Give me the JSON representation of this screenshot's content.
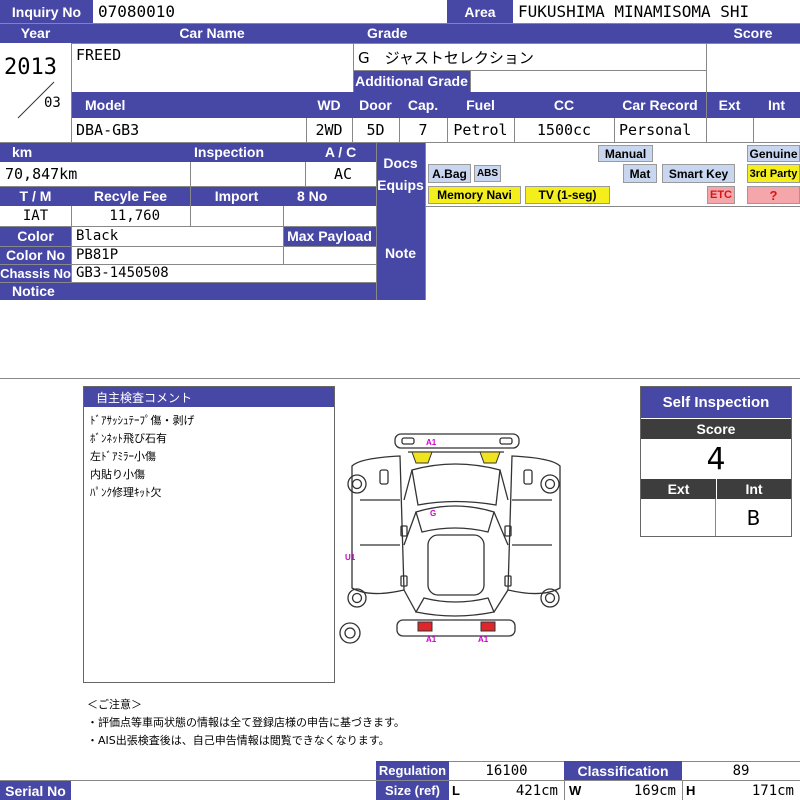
{
  "header": {
    "inquiry_label": "Inquiry No",
    "inquiry_value": "07080010",
    "area_label": "Area",
    "area_value": "FUKUSHIMA MINAMISOMA SHI"
  },
  "vehicle": {
    "year_label": "Year",
    "year_value": "2013",
    "month_value": "03",
    "car_name_label": "Car Name",
    "car_name_value": "FREED",
    "grade_label": "Grade",
    "grade_value": "G　ジャストセレクション",
    "additional_grade_label": "Additional Grade",
    "score_label": "Score",
    "score_value": ""
  },
  "specs": {
    "model_label": "Model",
    "model_value": "DBA-GB3",
    "wd_label": "WD",
    "wd_value": "2WD",
    "door_label": "Door",
    "door_value": "5D",
    "cap_label": "Cap.",
    "cap_value": "7",
    "fuel_label": "Fuel",
    "fuel_value": "Petrol",
    "cc_label": "CC",
    "cc_value": "1500cc",
    "record_label": "Car Record",
    "record_value": "Personal",
    "ext_label": "Ext",
    "int_label": "Int"
  },
  "details": {
    "km_label": "km",
    "km_value": "70,847km",
    "inspection_label": "Inspection",
    "ac_label": "A / C",
    "ac_value": "AC",
    "tm_label": "T / M",
    "tm_value": "IAT",
    "recycle_label": "Recyle Fee",
    "recycle_value": "11,760",
    "import_label": "Import",
    "eight_no_label": "8 No",
    "color_label": "Color",
    "color_value": "Black",
    "max_payload_label": "Max Payload",
    "color_no_label": "Color No",
    "color_no_value": "PB81P",
    "chassis_label": "Chassis No",
    "chassis_value": "GB3-1450508",
    "notice_label": "Notice"
  },
  "equipment": {
    "docs_label": "Docs",
    "equips_label": "Equips",
    "note_label": "Note",
    "tags": {
      "manual": "Manual",
      "genuine": "Genuine",
      "abag": "A.Bag",
      "abs": "ABS",
      "mat": "Mat",
      "smart_key": "Smart Key",
      "third_party": "3rd Party",
      "memory_navi": "Memory Navi",
      "tv": "TV (1-seg)",
      "etc": "ETC",
      "question": "?"
    }
  },
  "inspection_comments": {
    "title": "自主検査コメント",
    "lines": [
      "ﾄﾞｱｻｯｼｭﾃｰﾌﾟ傷・剥げ",
      "ﾎﾞﾝﾈｯﾄ飛び石有",
      "左ﾄﾞｱﾐﾗｰ小傷",
      "内貼り小傷",
      "ﾊﾟﾝｸ修理ｷｯﾄ欠"
    ]
  },
  "diagram": {
    "marks": {
      "front_a1": "A1",
      "hood_g": "G",
      "side_u1": "U1",
      "rear_a1_left": "A1",
      "rear_a1_right": "A1"
    },
    "colors": {
      "yellow": "#f1e41f",
      "red": "#e0262a",
      "mark": "#cc00cc"
    }
  },
  "self_inspection": {
    "title": "Self Inspection",
    "score_label": "Score",
    "score_value": "4",
    "ext_label": "Ext",
    "int_label": "Int",
    "ext_value": "",
    "int_value": "B"
  },
  "notes": {
    "heading": "＜ご注意＞",
    "line1": "・評価点等車両状態の情報は全て登録店様の申告に基づきます。",
    "line2": "・AIS出張検査後は、自己申告情報は閲覧できなくなります。"
  },
  "footer": {
    "serial_label": "Serial No",
    "regulation_label": "Regulation",
    "regulation_value": "16100",
    "classification_label": "Classification",
    "classification_value": "89",
    "size_label": "Size (ref)",
    "l_label": "L",
    "l_value": "421cm",
    "w_label": "W",
    "w_value": "169cm",
    "h_label": "H",
    "h_value": "171cm"
  },
  "colors": {
    "header_bg": "#4747a5",
    "tag_blue": "#c9d6ef",
    "tag_yellow": "#f3ee1c",
    "tag_pink": "#f4a6ab"
  }
}
